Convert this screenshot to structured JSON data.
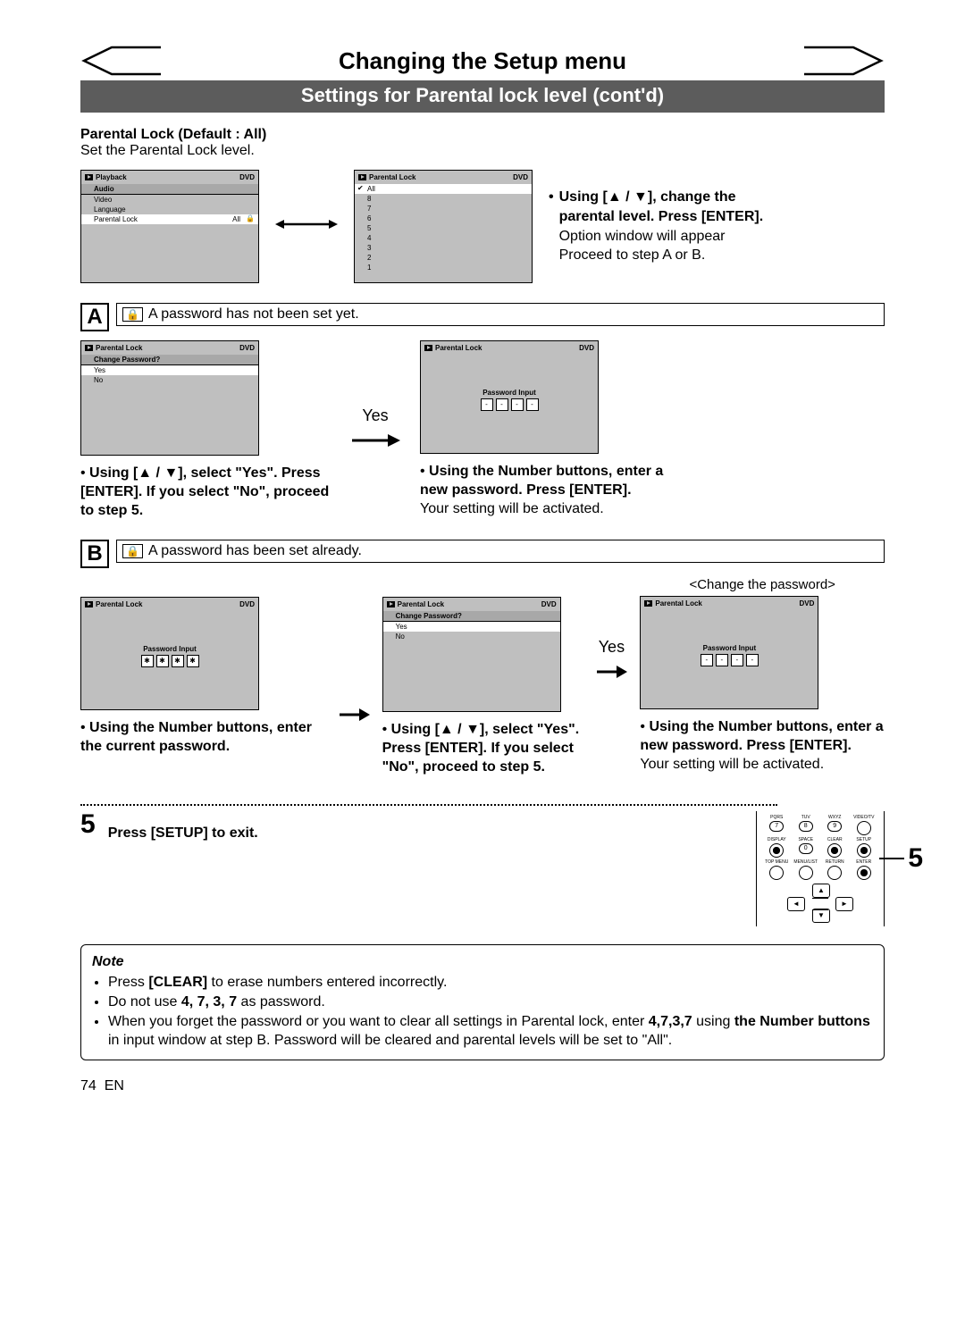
{
  "header": {
    "title": "Changing the Setup menu",
    "subtitle": "Settings for Parental lock level (cont'd)"
  },
  "intro": {
    "heading": "Parental Lock (Default : All)",
    "text": "Set the Parental Lock level."
  },
  "osd_playback": {
    "title": "Playback",
    "badge": "DVD",
    "items": {
      "audio": "Audio",
      "video": "Video",
      "language": "Language"
    },
    "parental_row": "Parental Lock",
    "parental_value": "All"
  },
  "osd_levels": {
    "title": "Parental Lock",
    "badge": "DVD",
    "options": [
      "All",
      "8",
      "7",
      "6",
      "5",
      "4",
      "3",
      "2",
      "1"
    ]
  },
  "side_instruction": {
    "line1_pre": "Using [",
    "line1_mid": " / ",
    "line1_post": "], change the parental level. Press [ENTER].",
    "line2": "Option window will appear",
    "line3": "Proceed to step A or B."
  },
  "scenario_a": {
    "letter": "A",
    "label": "A password has not been set yet.",
    "yes_arrow_label": "Yes",
    "osd_change": {
      "title": "Parental Lock",
      "badge": "DVD",
      "q": "Change Password?",
      "yes": "Yes",
      "no": "No"
    },
    "osd_pw": {
      "title": "Parental Lock",
      "badge": "DVD",
      "pw_label": "Password Input",
      "chars": [
        "-",
        "-",
        "-",
        "-"
      ]
    },
    "instr_left": "Using [▲ / ▼], select \"Yes\". Press [ENTER]. If you select \"No\", proceed to step 5.",
    "instr_right_b": "Using the Number buttons, enter a new password. Press [ENTER].",
    "instr_right_n": "Your setting will be activated."
  },
  "scenario_b": {
    "letter": "B",
    "label": "A password has been set already.",
    "change_caption": "<Change the password>",
    "yes_arrow_label": "Yes",
    "osd_pw1": {
      "title": "Parental Lock",
      "badge": "DVD",
      "pw_label": "Password Input",
      "chars": [
        "✱",
        "✱",
        "✱",
        "✱"
      ]
    },
    "osd_change": {
      "title": "Parental Lock",
      "badge": "DVD",
      "q": "Change Password?",
      "yes": "Yes",
      "no": "No"
    },
    "osd_pw2": {
      "title": "Parental Lock",
      "badge": "DVD",
      "pw_label": "Password Input",
      "chars": [
        "-",
        "-",
        "-",
        "-"
      ]
    },
    "instr1": "Using the Number buttons, enter the current password.",
    "instr2": "Using [▲ / ▼], select \"Yes\". Press [ENTER]. If you select \"No\", proceed to step 5.",
    "instr3b": "Using the Number buttons, enter a new password. Press [ENTER].",
    "instr3n": "Your setting will be activated."
  },
  "step5": {
    "num": "5",
    "text": "Press [SETUP] to exit.",
    "side_num": "5"
  },
  "remote": {
    "row1": [
      {
        "label": "PQRS",
        "val": "7"
      },
      {
        "label": "TUV",
        "val": "8"
      },
      {
        "label": "WXYZ",
        "val": "9"
      },
      {
        "label": "VIDEO/TV",
        "val": ""
      }
    ],
    "row2": [
      {
        "label": "DISPLAY"
      },
      {
        "label": "SPACE",
        "val": "0"
      },
      {
        "label": "CLEAR"
      },
      {
        "label": "SETUP"
      }
    ],
    "row3": [
      {
        "label": "TOP MENU"
      },
      {
        "label": "MENU/LIST"
      },
      {
        "label": "RETURN"
      },
      {
        "label": "ENTER"
      }
    ]
  },
  "note": {
    "title": "Note",
    "items": [
      {
        "pre": "Press ",
        "bold1": "[CLEAR]",
        "post": " to erase numbers entered incorrectly."
      },
      {
        "pre": "Do not use ",
        "bold1": "4, 7, 3, 7",
        "post": " as password."
      },
      {
        "pre": "When you forget the password or you want to clear all settings in Parental lock, enter ",
        "bold1": "4,7,3,7",
        "mid": " using ",
        "bold2": "the Number buttons",
        "post": " in input window at step B. Password will be cleared and parental levels will be set to \"All\"."
      }
    ]
  },
  "footer": {
    "page": "74",
    "lang": "EN"
  }
}
